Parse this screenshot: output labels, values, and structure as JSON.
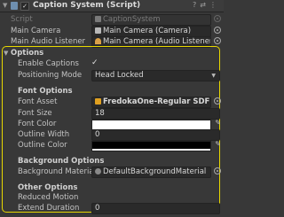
{
  "header": {
    "title": "Caption System (Script)",
    "enabled": "✓"
  },
  "script_row": {
    "label": "Script",
    "value": "CaptionSystem"
  },
  "refs": [
    {
      "label": "Main Camera",
      "value": "Main Camera (Camera)"
    },
    {
      "label": "Main Audio Listener",
      "value": "Main Camera (Audio Listener)"
    }
  ],
  "options": {
    "title": "Options",
    "enable_captions": {
      "label": "Enable Captions",
      "value": "✓"
    },
    "positioning": {
      "label": "Positioning Mode",
      "value": "Head Locked"
    },
    "font_section": "Font Options",
    "font_asset": {
      "label": "Font Asset",
      "value": "FredokaOne-Regular SDF (TMP_F"
    },
    "font_size": {
      "label": "Font Size",
      "value": "18"
    },
    "font_color": {
      "label": "Font Color"
    },
    "outline_width": {
      "label": "Outline Width",
      "value": "0"
    },
    "outline_color": {
      "label": "Outline Color"
    },
    "background_section": "Background Options",
    "background_material": {
      "label": "Background Material",
      "value": "DefaultBackgroundMaterial"
    },
    "other_section": "Other Options",
    "reduced_motion": {
      "label": "Reduced Motion"
    },
    "extend_duration": {
      "label": "Extend Duration",
      "value": "0"
    }
  },
  "colors": {
    "highlight": "#e8d800",
    "font_color": "#ffffff",
    "outline_color": "#000000"
  }
}
